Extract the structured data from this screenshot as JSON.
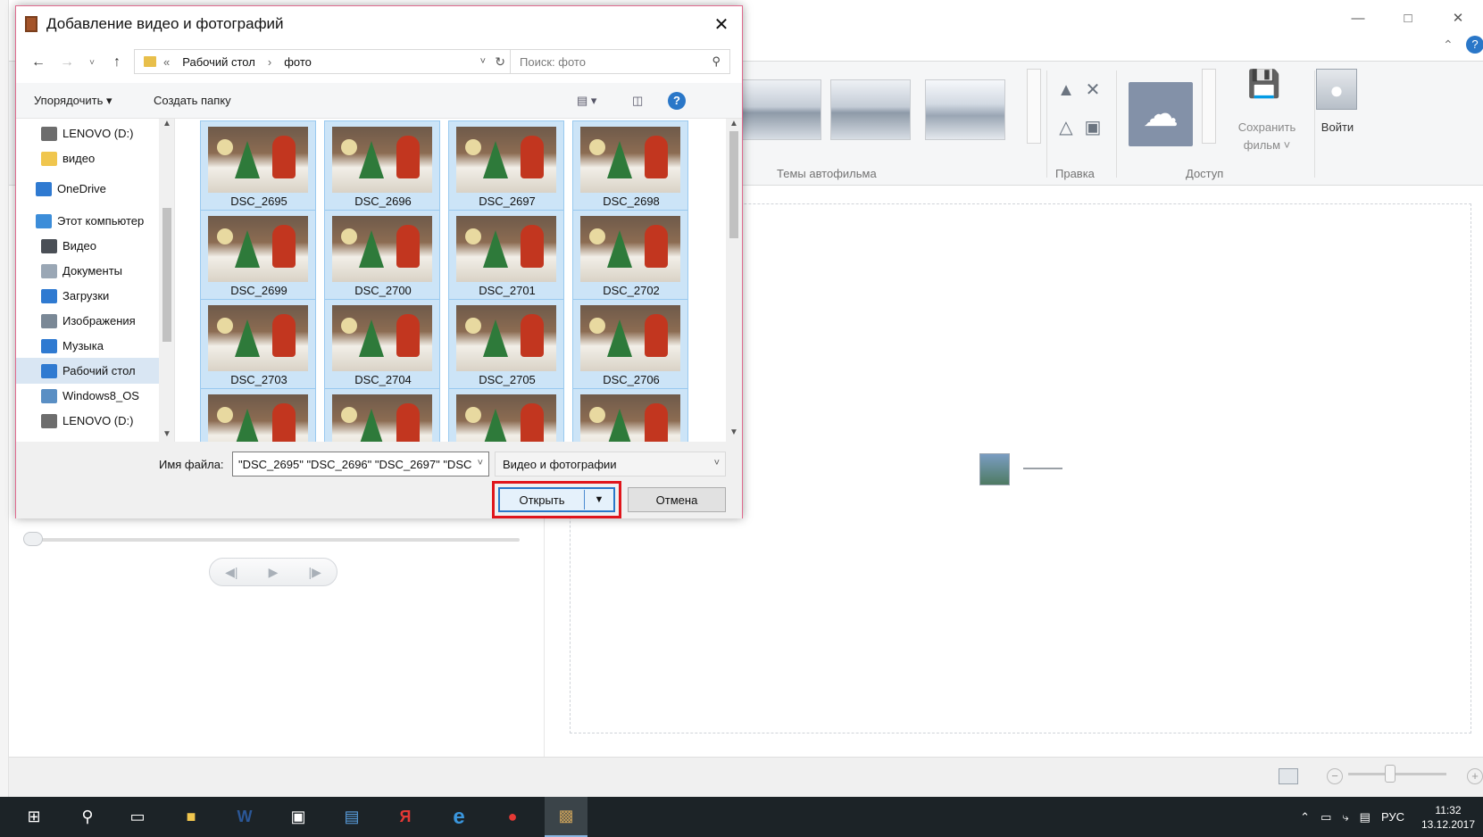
{
  "dialog": {
    "title": "Добавление видео и фотографий",
    "address": {
      "prefix": "«",
      "crumbs": [
        "Рабочий стол",
        "фото"
      ],
      "sep": "›"
    },
    "search_placeholder": "Поиск: фото",
    "commands": {
      "organize": "Упорядочить ▾",
      "new_folder": "Создать папку"
    },
    "nav_items": [
      {
        "label": "LENOVO (D:)",
        "icon": "drive-icon",
        "color": "#6d6d6d"
      },
      {
        "label": "видео",
        "icon": "folder-icon",
        "color": "#f0c64e"
      },
      {
        "label": "OneDrive",
        "icon": "onedrive-icon",
        "color": "#2f7ad1"
      },
      {
        "label": "Этот компьютер",
        "icon": "computer-icon",
        "color": "#3c8dd9"
      },
      {
        "label": "Видео",
        "icon": "video-icon",
        "color": "#4a4f56"
      },
      {
        "label": "Документы",
        "icon": "documents-icon",
        "color": "#9aa7b5"
      },
      {
        "label": "Загрузки",
        "icon": "downloads-icon",
        "color": "#2f7ad1"
      },
      {
        "label": "Изображения",
        "icon": "pictures-icon",
        "color": "#7a8896"
      },
      {
        "label": "Музыка",
        "icon": "music-icon",
        "color": "#2f7ad1"
      },
      {
        "label": "Рабочий стол",
        "icon": "desktop-icon",
        "color": "#2f7ad1"
      },
      {
        "label": "Windows8_OS",
        "icon": "windows-drive-icon",
        "color": "#5a8fc4"
      },
      {
        "label": "LENOVO (D:)",
        "icon": "drive-icon",
        "color": "#6d6d6d"
      }
    ],
    "files": [
      "DSC_2695",
      "DSC_2696",
      "DSC_2697",
      "DSC_2698",
      "DSC_2699",
      "DSC_2700",
      "DSC_2701",
      "DSC_2702",
      "DSC_2703",
      "DSC_2704",
      "DSC_2705",
      "DSC_2706",
      "",
      "",
      "",
      ""
    ],
    "filename_label": "Имя файла:",
    "filename_value": "\"DSC_2695\" \"DSC_2696\" \"DSC_2697\" \"DSC",
    "filetype": "Видео и фотографии",
    "open_label": "Открыть",
    "cancel_label": "Отмена"
  },
  "ribbon": {
    "themes_label": "Темы автофильма",
    "edit_label": "Правка",
    "access_label": "Доступ",
    "save_movie": "Сохранить фильм ˅",
    "sign_in": "Войти"
  },
  "taskbar": {
    "language": "РУС",
    "time": "11:32",
    "date": "13.12.2017"
  },
  "colors": {
    "accent": "#2a77c8",
    "highlight": "#e0151b",
    "selection": "#cce4f7"
  }
}
